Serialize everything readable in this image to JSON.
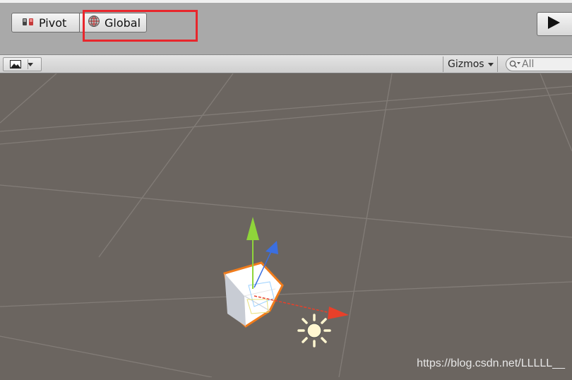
{
  "toolbar": {
    "pivot_label": "Pivot",
    "global_label": "Global"
  },
  "scene_bar": {
    "gizmos_label": "Gizmos",
    "search_placeholder": "All"
  },
  "watermark": "https://blog.csdn.net/LLLLL__",
  "icons": [
    "pivot-icon",
    "global-icon",
    "play-icon",
    "image-icon",
    "dropdown-icon",
    "search-icon",
    "light-icon"
  ],
  "colors": {
    "highlight": "#e8262c",
    "scene_background": "#6b6560",
    "axis_x": "#e8402a",
    "axis_y": "#8fd53a",
    "axis_z": "#3b6fe0",
    "selection_outline": "#f07c1c"
  }
}
